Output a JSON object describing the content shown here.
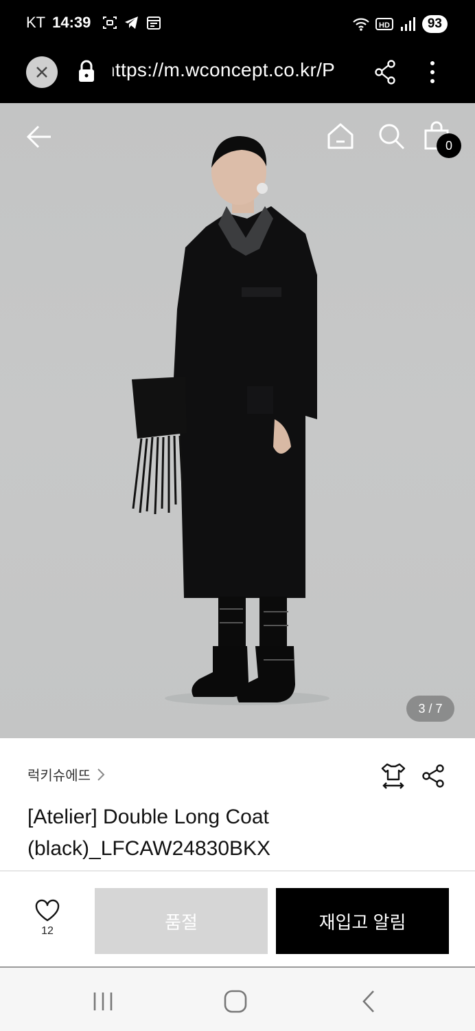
{
  "status_bar": {
    "carrier": "KT",
    "time": "14:39",
    "battery": "93",
    "network_label": "HD"
  },
  "browser": {
    "url": "https://m.wconcept.co.kr/P"
  },
  "hero": {
    "cart_count": "0",
    "page_indicator": "3 / 7"
  },
  "product": {
    "brand": "럭키슈에뜨",
    "title_line1": "[Atelier] Double Long Coat",
    "title_line2": "(black)_LFCAW24830BKX"
  },
  "actions": {
    "wish_count": "12",
    "soldout_label": "품절",
    "restock_label": "재입고 알림"
  }
}
